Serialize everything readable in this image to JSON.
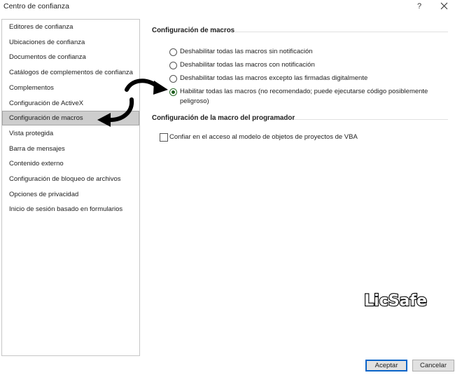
{
  "window": {
    "title": "Centro de confianza",
    "help_label": "?"
  },
  "sidebar": {
    "items": [
      {
        "label": "Editores de confianza"
      },
      {
        "label": "Ubicaciones de confianza"
      },
      {
        "label": "Documentos de confianza"
      },
      {
        "label": "Catálogos de complementos de confianza"
      },
      {
        "label": "Complementos"
      },
      {
        "label": "Configuración de ActiveX"
      },
      {
        "label": "Configuración de macros",
        "selected": true
      },
      {
        "label": "Vista protegida"
      },
      {
        "label": "Barra de mensajes"
      },
      {
        "label": "Contenido externo"
      },
      {
        "label": "Configuración de bloqueo de archivos"
      },
      {
        "label": "Opciones de privacidad"
      },
      {
        "label": "Inicio de sesión basado en formularios"
      }
    ]
  },
  "macros": {
    "section_title": "Configuración de macros",
    "options": [
      {
        "label": "Deshabilitar todas las macros sin notificación",
        "checked": false
      },
      {
        "label": "Deshabilitar todas las macros con notificación",
        "checked": false
      },
      {
        "label": "Deshabilitar todas las macros excepto las firmadas digitalmente",
        "checked": false
      },
      {
        "label": "Habilitar todas las macros (no recomendado; puede ejecutarse código posiblemente peligroso)",
        "checked": true
      }
    ]
  },
  "developer": {
    "section_title": "Configuración de la macro del programador",
    "vba_trust_label": "Confiar en el acceso al modelo de objetos de proyectos de VBA",
    "vba_trust_checked": false
  },
  "watermark": {
    "text": "LicSafe"
  },
  "footer": {
    "ok_label": "Aceptar",
    "cancel_label": "Cancelar"
  },
  "colors": {
    "selected_bg": "#cdcdcd",
    "primary_border": "#0a64c8",
    "radio_checked": "#1f5f1f"
  }
}
